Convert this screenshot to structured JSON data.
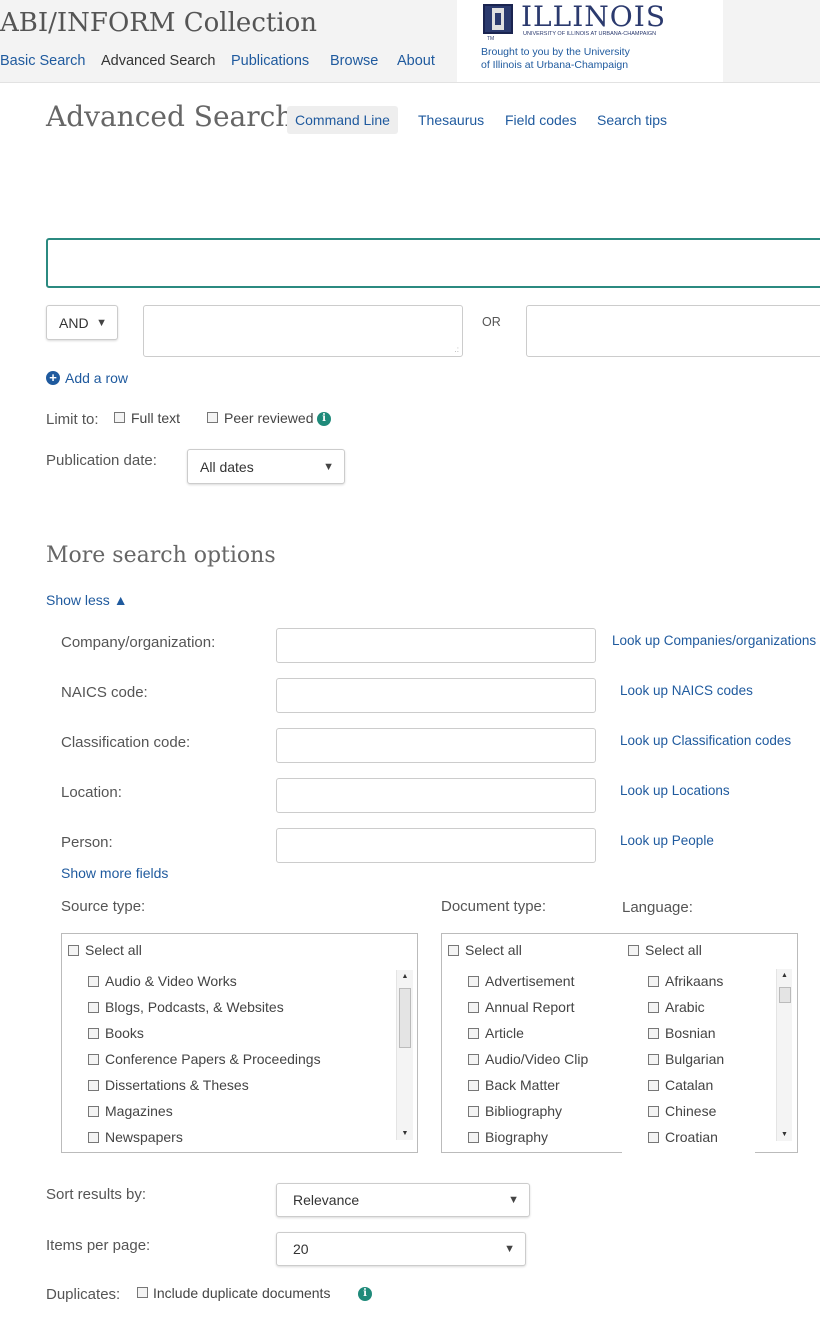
{
  "app": {
    "title": "ABI/INFORM Collection",
    "nav": [
      "Basic Search",
      "Advanced Search",
      "Publications",
      "Browse",
      "About"
    ]
  },
  "logo": {
    "word": "ILLINOIS",
    "sub": "UNIVERSITY OF ILLINOIS AT URBANA-CHAMPAIGN",
    "tm": "TM",
    "brought": "Brought to you by the University of Illinois at Urbana-Champaign"
  },
  "page": {
    "title": "Advanced Search",
    "command_line": "Command Line",
    "tools": [
      "Thesaurus",
      "Field codes",
      "Search tips"
    ]
  },
  "query": {
    "main_value": "",
    "operator": "AND",
    "row_value": "",
    "or_label": "OR",
    "or_value": "",
    "add_row": "Add a row"
  },
  "limits": {
    "label": "Limit to:",
    "full_text": "Full text",
    "peer_reviewed": "Peer reviewed",
    "info": "i"
  },
  "pubdate": {
    "label": "Publication date:",
    "value": "All dates"
  },
  "more": {
    "title": "More search options",
    "show_less": "Show less ▲",
    "fields": [
      {
        "label": "Company/organization:",
        "lookup": "Look up Companies/organizations"
      },
      {
        "label": "NAICS code:",
        "lookup": "Look up NAICS codes"
      },
      {
        "label": "Classification code:",
        "lookup": "Look up Classification codes"
      },
      {
        "label": "Location:",
        "lookup": "Look up Locations"
      },
      {
        "label": "Person:",
        "lookup": "Look up People"
      }
    ],
    "show_more_fields": "Show more fields"
  },
  "source_type": {
    "label": "Source type:",
    "select_all": "Select all",
    "items": [
      "Audio & Video Works",
      "Blogs, Podcasts, & Websites",
      "Books",
      "Conference Papers & Proceedings",
      "Dissertations & Theses",
      "Magazines",
      "Newspapers"
    ]
  },
  "document_type": {
    "label": "Document type:",
    "select_all": "Select all",
    "items": [
      "Advertisement",
      "Annual Report",
      "Article",
      "Audio/Video Clip",
      "Back Matter",
      "Bibliography",
      "Biography"
    ]
  },
  "language": {
    "label": "Language:",
    "select_all": "Select all",
    "items": [
      "Afrikaans",
      "Arabic",
      "Bosnian",
      "Bulgarian",
      "Catalan",
      "Chinese",
      "Croatian"
    ]
  },
  "sort": {
    "label": "Sort results by:",
    "value": "Relevance"
  },
  "items_per_page": {
    "label": "Items per page:",
    "value": "20"
  },
  "duplicates": {
    "label": "Duplicates:",
    "checkbox_label": "Include duplicate documents",
    "info": "i"
  },
  "icons": {
    "dropdown": "▼",
    "scroll_up": "▲",
    "scroll_down": "▼",
    "resize": ".:"
  }
}
